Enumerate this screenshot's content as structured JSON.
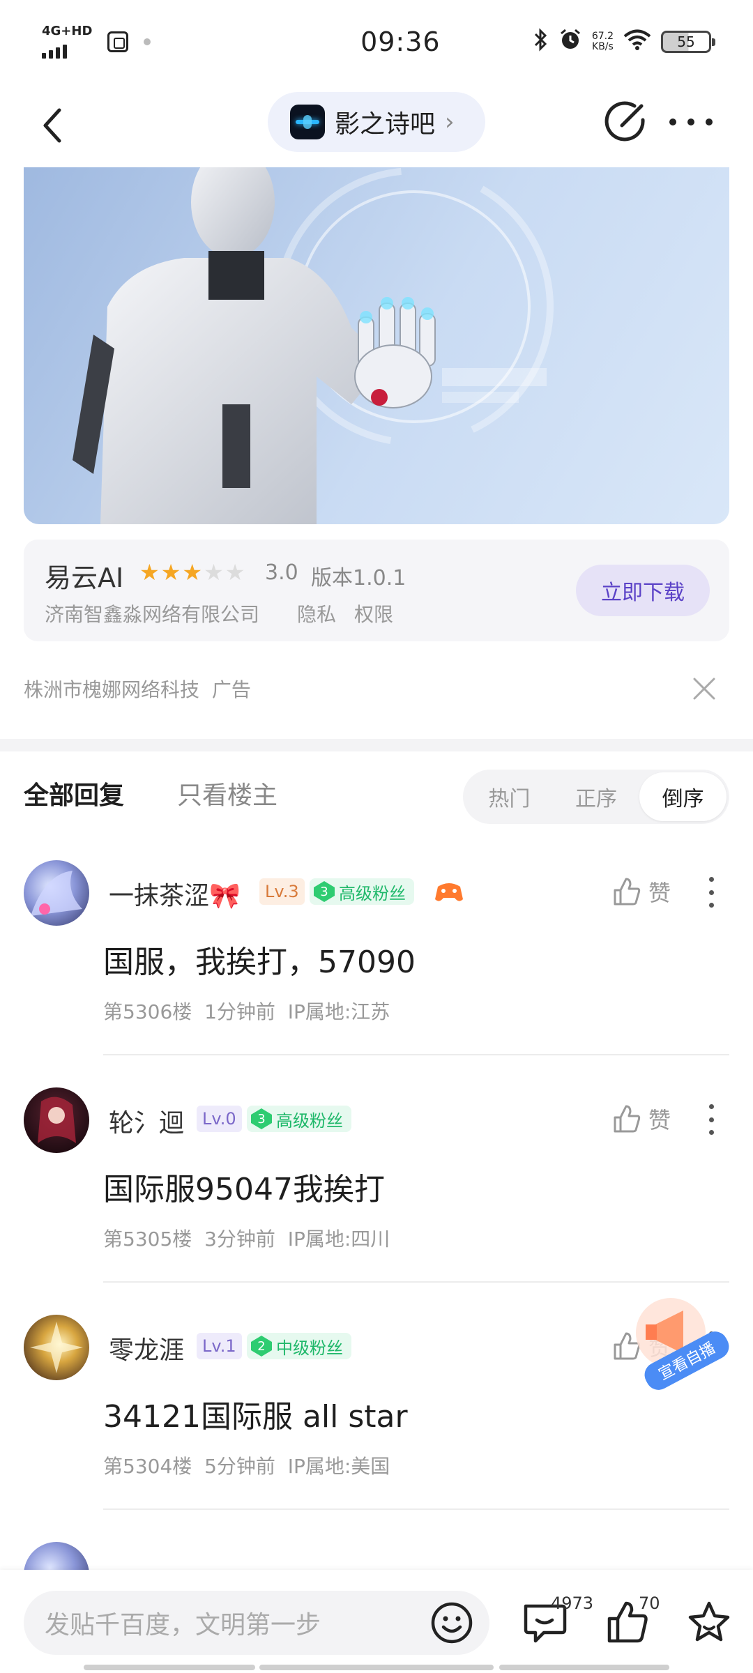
{
  "status_bar": {
    "network": "4G+HD",
    "time": "09:36",
    "speed_value": "67.2",
    "speed_unit": "KB/s",
    "battery": "55"
  },
  "nav": {
    "forum_name": "影之诗吧"
  },
  "ad": {
    "app_name": "易云AI",
    "rating_stars": 3,
    "rating": "3.0",
    "version": "版本1.0.1",
    "company": "济南智鑫淼网络有限公司",
    "privacy": "隐私",
    "permissions": "权限",
    "download_label": "立即下载",
    "source": "株洲市槐娜网络科技",
    "ad_tag": "广告"
  },
  "tabs": {
    "all": "全部回复",
    "op_only": "只看楼主",
    "sort_options": [
      "热门",
      "正序",
      "倒序"
    ],
    "sort_active": "倒序"
  },
  "posts": [
    {
      "username": "一抹茶涩🎀",
      "level": "Lv.3",
      "fan_level": "3",
      "fan_label": "高级粉丝",
      "content": "国服，我挨打，57090",
      "floor": "第5306楼",
      "time": "1分钟前",
      "ip": "IP属地:江苏",
      "like_label": "赞"
    },
    {
      "username": "轮氵迴",
      "level": "Lv.0",
      "fan_level": "3",
      "fan_label": "高级粉丝",
      "content": "国际服95047我挨打",
      "floor": "第5305楼",
      "time": "3分钟前",
      "ip": "IP属地:四川",
      "like_label": "赞"
    },
    {
      "username": "零龙涯",
      "level": "Lv.1",
      "fan_level": "2",
      "fan_label": "中级粉丝",
      "content": "34121国际服 all star",
      "floor": "第5304楼",
      "time": "5分钟前",
      "ip": "IP属地:美国",
      "like_label": "赞"
    }
  ],
  "float_badge": "宣看自播",
  "bottom_bar": {
    "input_placeholder": "发贴千百度，文明第一步",
    "comment_count": "4973",
    "like_count": "70"
  },
  "colors": {
    "accent_purple": "#5b42c7",
    "fan_green": "#1fb86a",
    "star": "#f5a623"
  }
}
